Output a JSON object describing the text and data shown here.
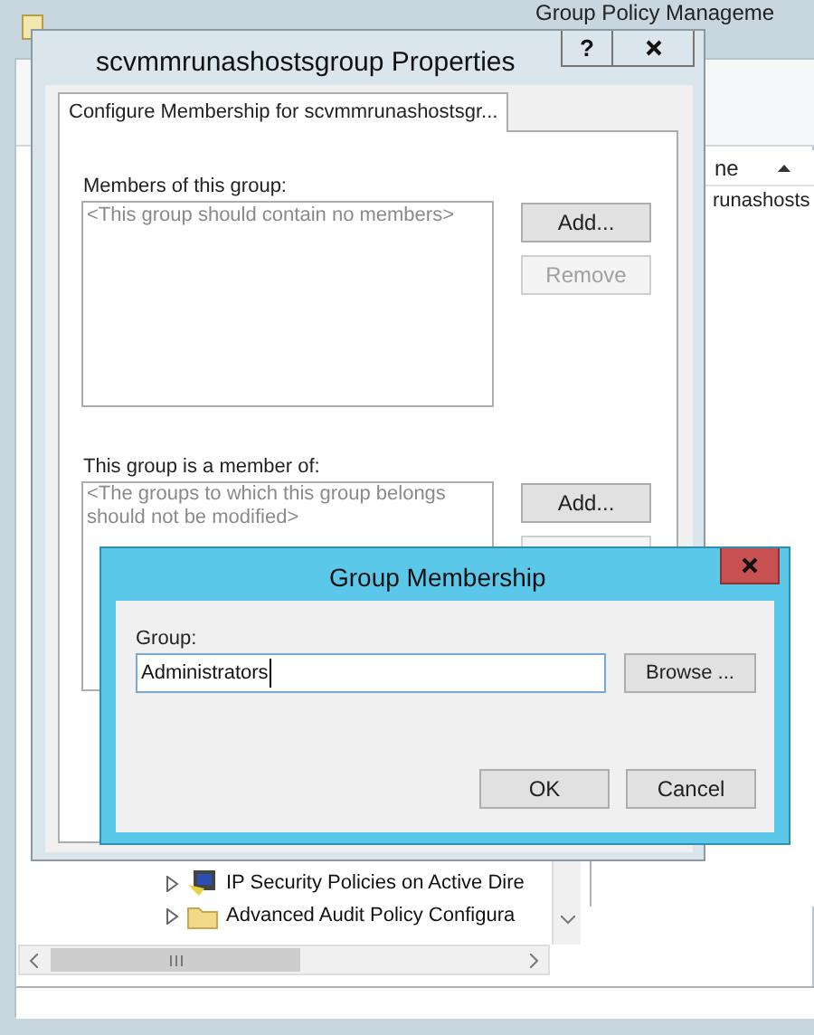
{
  "background_window": {
    "title": "Group Policy Manageme",
    "right_pane": {
      "column_header": "ne",
      "rows": [
        "runashosts"
      ]
    },
    "tree": {
      "items": [
        {
          "label": "IP Security Policies on Active Dire",
          "kind": "computer",
          "expanded": false
        },
        {
          "label": "Advanced Audit Policy Configura",
          "kind": "folder",
          "expanded": false
        }
      ]
    }
  },
  "properties_dialog": {
    "title": "scvmmrunashostsgroup Properties",
    "help_button": "?",
    "tabs": [
      {
        "label": "Configure Membership for scvmmrunashostsgr...",
        "selected": true
      }
    ],
    "members": {
      "label": "Members of this group:",
      "placeholder": "<This group should contain no members>",
      "buttons": [
        {
          "label": "Add...",
          "disabled": false
        },
        {
          "label": "Remove",
          "disabled": true
        }
      ]
    },
    "member_of": {
      "label": "This group is a member of:",
      "placeholder": "<The groups to which this group belongs should not be modified>",
      "buttons": [
        {
          "label": "Add...",
          "disabled": false
        }
      ]
    }
  },
  "group_membership_dialog": {
    "title": "Group Membership",
    "group_label": "Group:",
    "group_value": "Administrators",
    "browse_button": "Browse ...",
    "buttons": [
      "OK",
      "Cancel"
    ]
  }
}
